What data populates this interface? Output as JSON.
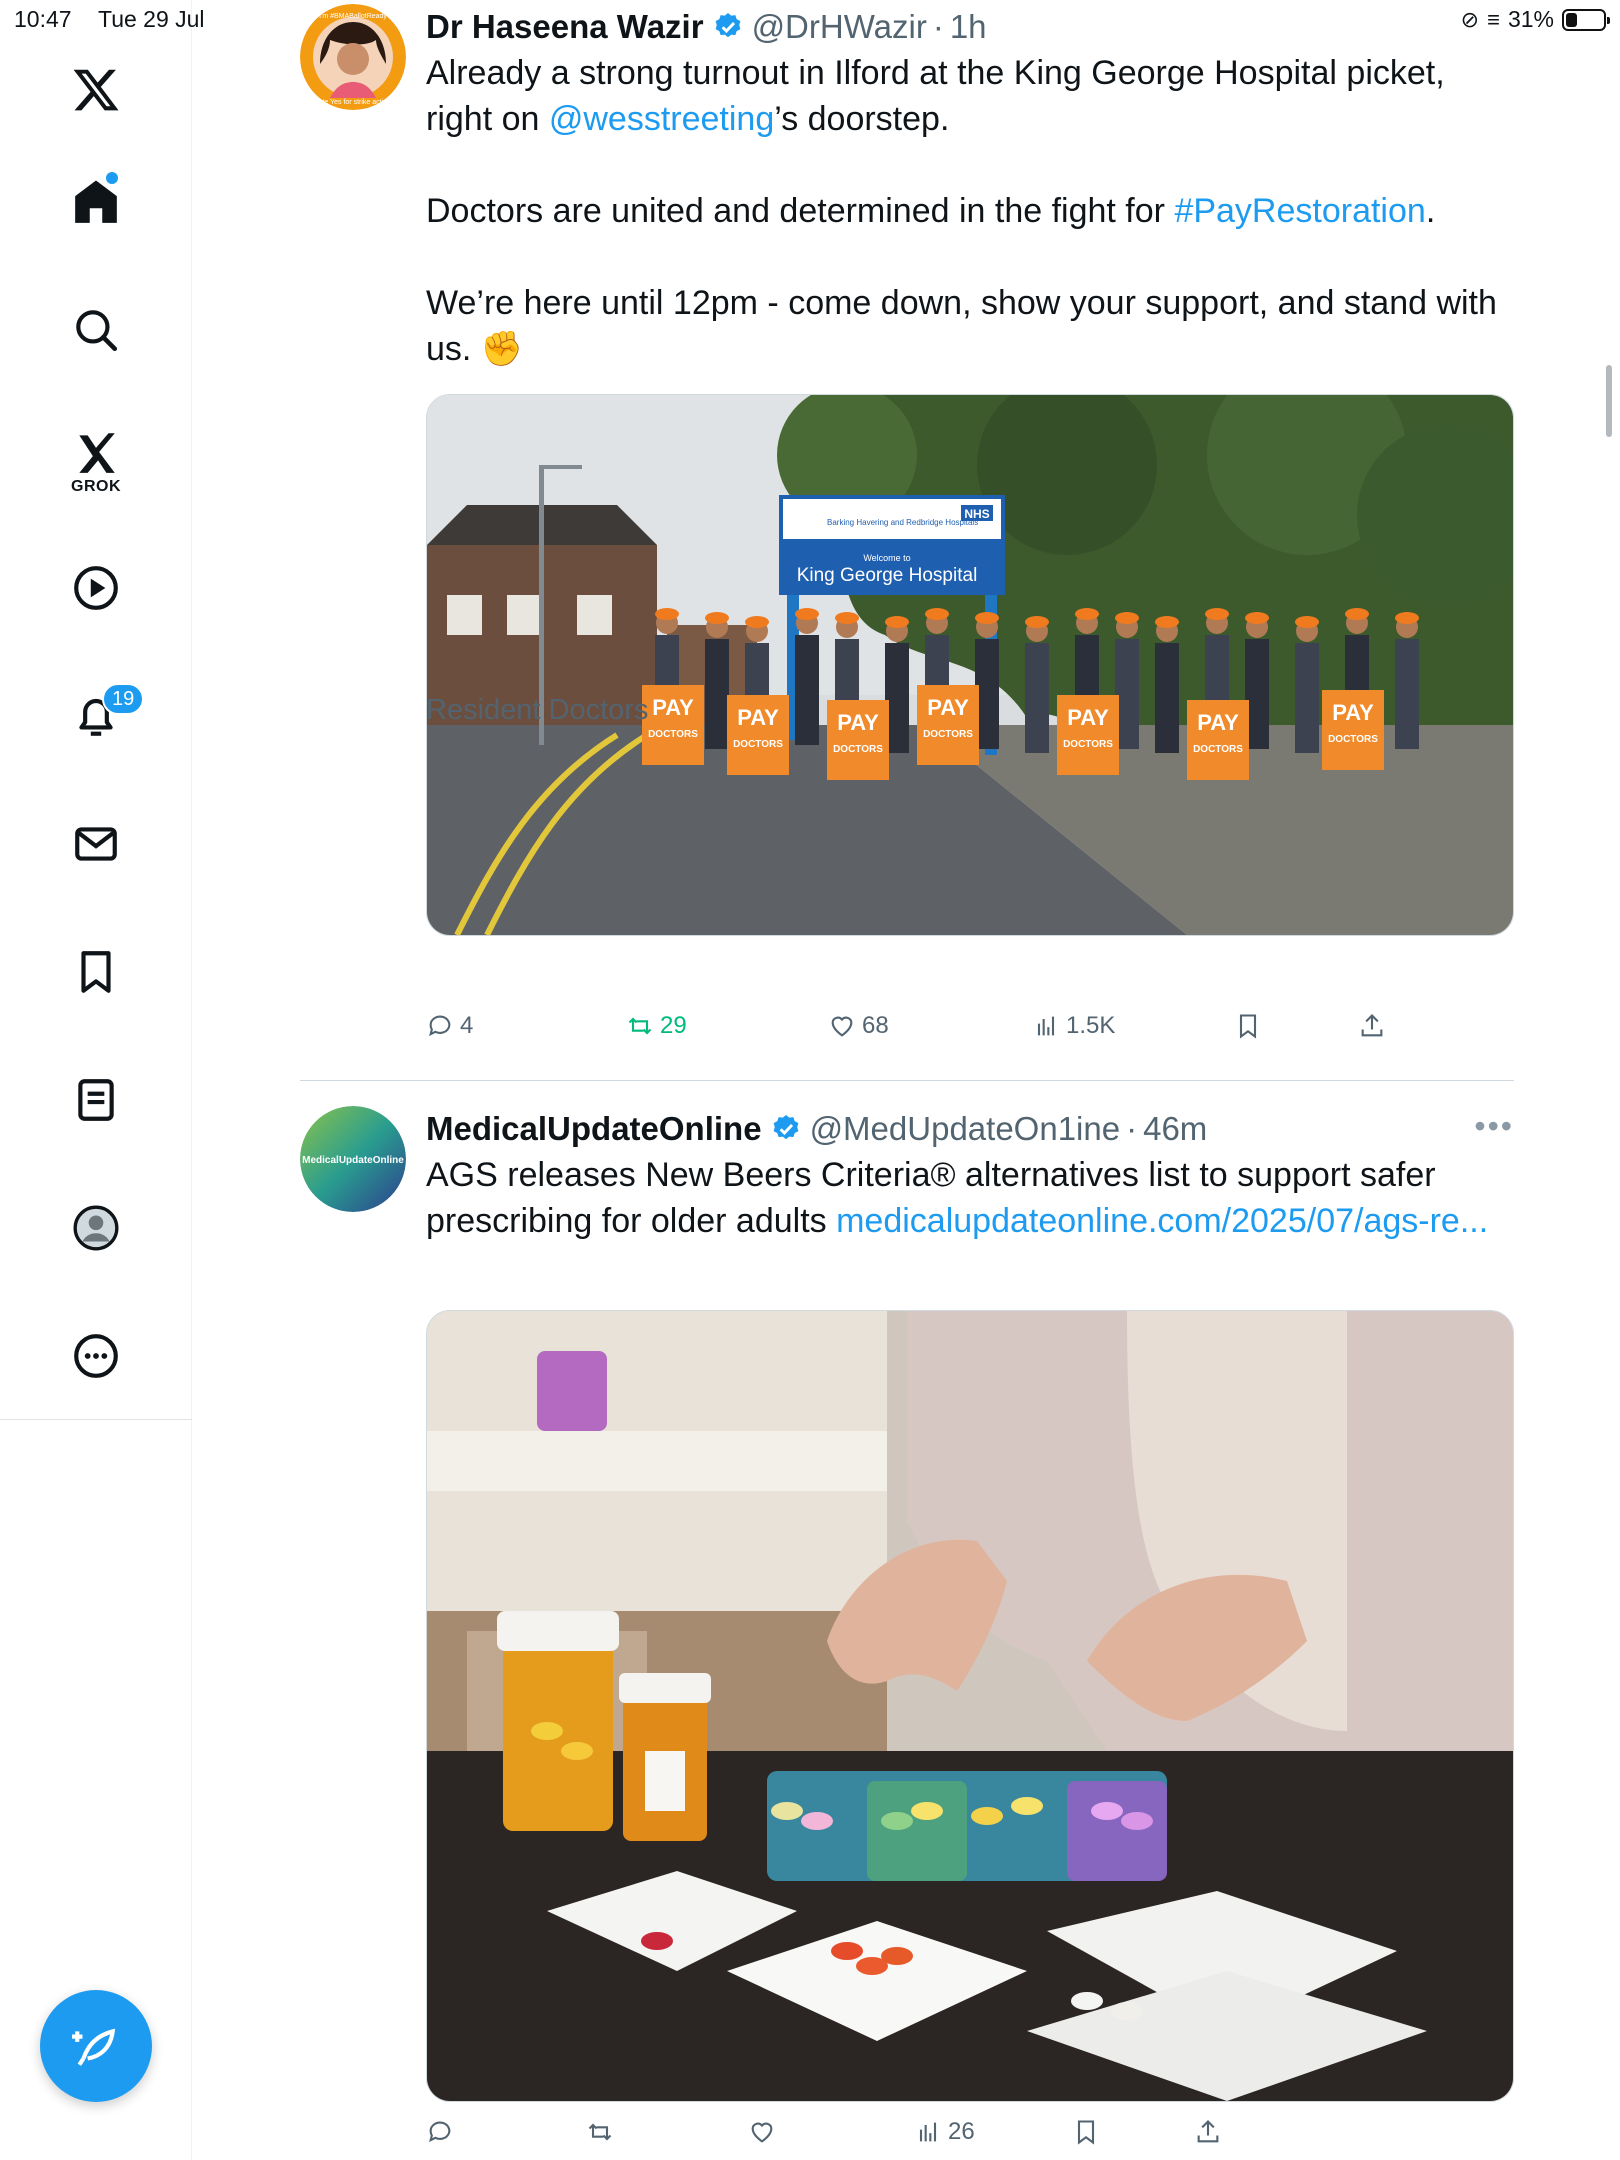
{
  "status_bar": {
    "time": "10:47",
    "date": "Tue 29 Jul",
    "battery": "31%",
    "battery_fraction": 0.31
  },
  "sidebar": {
    "grok_label": "GROK",
    "notifications_badge": "19",
    "accent_color": "#1d9bf0"
  },
  "tweets": [
    {
      "display_name": "Dr Haseena Wazir",
      "handle": "@DrHWazir",
      "dot": "·",
      "time": "1h",
      "avatar_text_top": "I'm #BMABallotReady",
      "avatar_text_bottom": "vote Yes for strike action",
      "text_1": "Already a strong turnout in Ilford at the King George Hospital picket, right on ",
      "mention": "@wesstreeting",
      "text_2": "’s doorstep.",
      "text_3": "Doctors are united and determined in the fight for ",
      "hashtag": "#PayRestoration",
      "text_4": ".",
      "text_5": "We’re here until 12pm - come down, show your support, and stand with us. ✊",
      "image_sign_small": "Barking Havering and Redbridge Hospitals",
      "image_sign_nhs": "NHS",
      "image_sign_welcome": "Welcome to",
      "image_sign_name": "King George Hospital",
      "image_placard": "PAY",
      "image_placard_sub": "DOCTORS",
      "caption": "Resident Doctors",
      "replies": "4",
      "retweets": "29",
      "likes": "68",
      "views": "1.5K"
    },
    {
      "display_name": "MedicalUpdateOnline",
      "handle": "@MedUpdateOn1ine",
      "dot": "·",
      "time": "46m",
      "avatar_text": "MedicalUpdateOnline",
      "text_1": "AGS releases New Beers Criteria® alternatives list to support safer prescribing for older adults ",
      "link": "medicalupdateonline.com/2025/07/ags-re...",
      "replies": "",
      "retweets": "",
      "likes": "",
      "views": "26"
    }
  ]
}
